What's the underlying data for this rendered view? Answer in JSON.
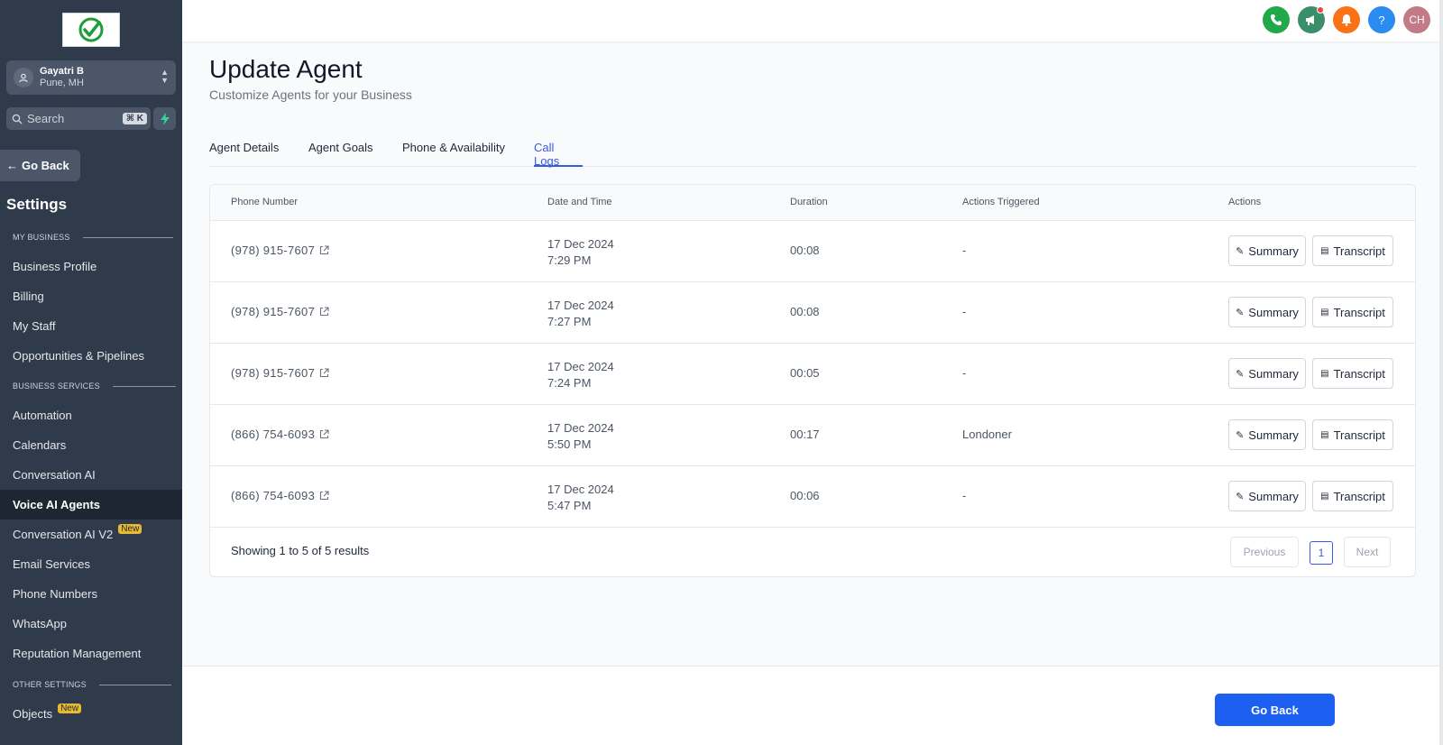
{
  "sidebar": {
    "account": {
      "name": "Gayatri B",
      "location": "Pune, MH"
    },
    "search": {
      "placeholder": "Search",
      "shortcut": "⌘ K"
    },
    "go_back": "Go Back",
    "title": "Settings",
    "sections": {
      "my_business": "MY BUSINESS",
      "business_services": "BUSINESS SERVICES",
      "other_settings": "OTHER SETTINGS"
    },
    "items": [
      {
        "label": "Business Profile"
      },
      {
        "label": "Billing"
      },
      {
        "label": "My Staff"
      },
      {
        "label": "Opportunities & Pipelines"
      },
      {
        "label": "Automation"
      },
      {
        "label": "Calendars"
      },
      {
        "label": "Conversation AI"
      },
      {
        "label": "Voice AI Agents",
        "active": true
      },
      {
        "label": "Conversation AI V2",
        "badge": "New"
      },
      {
        "label": "Email Services"
      },
      {
        "label": "Phone Numbers"
      },
      {
        "label": "WhatsApp"
      },
      {
        "label": "Reputation Management"
      },
      {
        "label": "Objects",
        "badge": "New"
      }
    ]
  },
  "topbar": {
    "avatar_initials": "CH",
    "help": "?"
  },
  "page": {
    "title": "Update Agent",
    "subtitle": "Customize Agents for your Business"
  },
  "tabs": [
    {
      "label": "Agent Details"
    },
    {
      "label": "Agent Goals"
    },
    {
      "label": "Phone & Availability"
    },
    {
      "label": "Call Logs",
      "active": true
    }
  ],
  "table": {
    "headers": [
      "Phone Number",
      "Date and Time",
      "Duration",
      "Actions Triggered",
      "Actions"
    ],
    "rows": [
      {
        "phone": "(978) 915-7607",
        "date": "17 Dec 2024",
        "time": "7:29 PM",
        "duration": "00:08",
        "actions_triggered": "-"
      },
      {
        "phone": "(978) 915-7607",
        "date": "17 Dec 2024",
        "time": "7:27 PM",
        "duration": "00:08",
        "actions_triggered": "-"
      },
      {
        "phone": "(978) 915-7607",
        "date": "17 Dec 2024",
        "time": "7:24 PM",
        "duration": "00:05",
        "actions_triggered": "-"
      },
      {
        "phone": "(866) 754-6093",
        "date": "17 Dec 2024",
        "time": "5:50 PM",
        "duration": "00:17",
        "actions_triggered": "Londoner"
      },
      {
        "phone": "(866) 754-6093",
        "date": "17 Dec 2024",
        "time": "5:47 PM",
        "duration": "00:06",
        "actions_triggered": "-"
      }
    ],
    "summary_label": "Summary",
    "transcript_label": "Transcript",
    "showing": "Showing 1 to 5 of 5 results",
    "pagination": {
      "previous": "Previous",
      "current": "1",
      "next": "Next"
    }
  },
  "footer": {
    "go_back": "Go Back"
  },
  "colors": {
    "primary": "#1d5ff0",
    "tab_active": "#3b5bdb",
    "sidebar_bg": "#2f3a4a"
  }
}
